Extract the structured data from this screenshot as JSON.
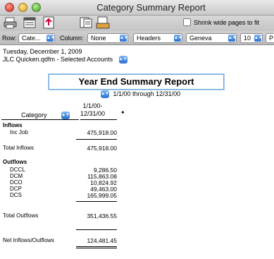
{
  "window": {
    "title": "Category Summary Report"
  },
  "toolbar": {
    "shrink_label": "Shrink wide pages to fit",
    "icons": [
      "print-icon",
      "report-icon",
      "export-icon",
      "memorize-icon",
      "customize-icon"
    ]
  },
  "rowbar": {
    "row_label": "Row:",
    "row_value": "Cate...",
    "column_label": "Column:",
    "column_value": "None",
    "headers_value": "Headers",
    "font_value": "Geneva",
    "size_value": "10",
    "extra_value": "P"
  },
  "report": {
    "date_line": "Tuesday, December 1, 2009",
    "account_line": "JLC Quicken.qdfm - Selected Accounts",
    "title": "Year End Summary Report",
    "range": "1/1/00 through 12/31/00",
    "col_category": "Category",
    "col_date_1": "1/1/00-",
    "col_date_2": "12/31/00",
    "inflows_header": "Inflows",
    "inflows": [
      {
        "label": "Inc Job",
        "value": "475,918.00"
      }
    ],
    "total_inflows_label": "Total Inflows",
    "total_inflows_value": "475,918.00",
    "outflows_header": "Outflows",
    "outflows": [
      {
        "label": "DCCL",
        "value": "9,286.50"
      },
      {
        "label": "DCM",
        "value": "115,863.08"
      },
      {
        "label": "DCO",
        "value": "10,824.92"
      },
      {
        "label": "DCP",
        "value": "49,463.00"
      },
      {
        "label": "DCS",
        "value": "165,999.05"
      }
    ],
    "total_outflows_label": "Total Outflows",
    "total_outflows_value": "351,436.55",
    "net_label": "Net Inflows/Outflows",
    "net_value": "124,481.45"
  }
}
